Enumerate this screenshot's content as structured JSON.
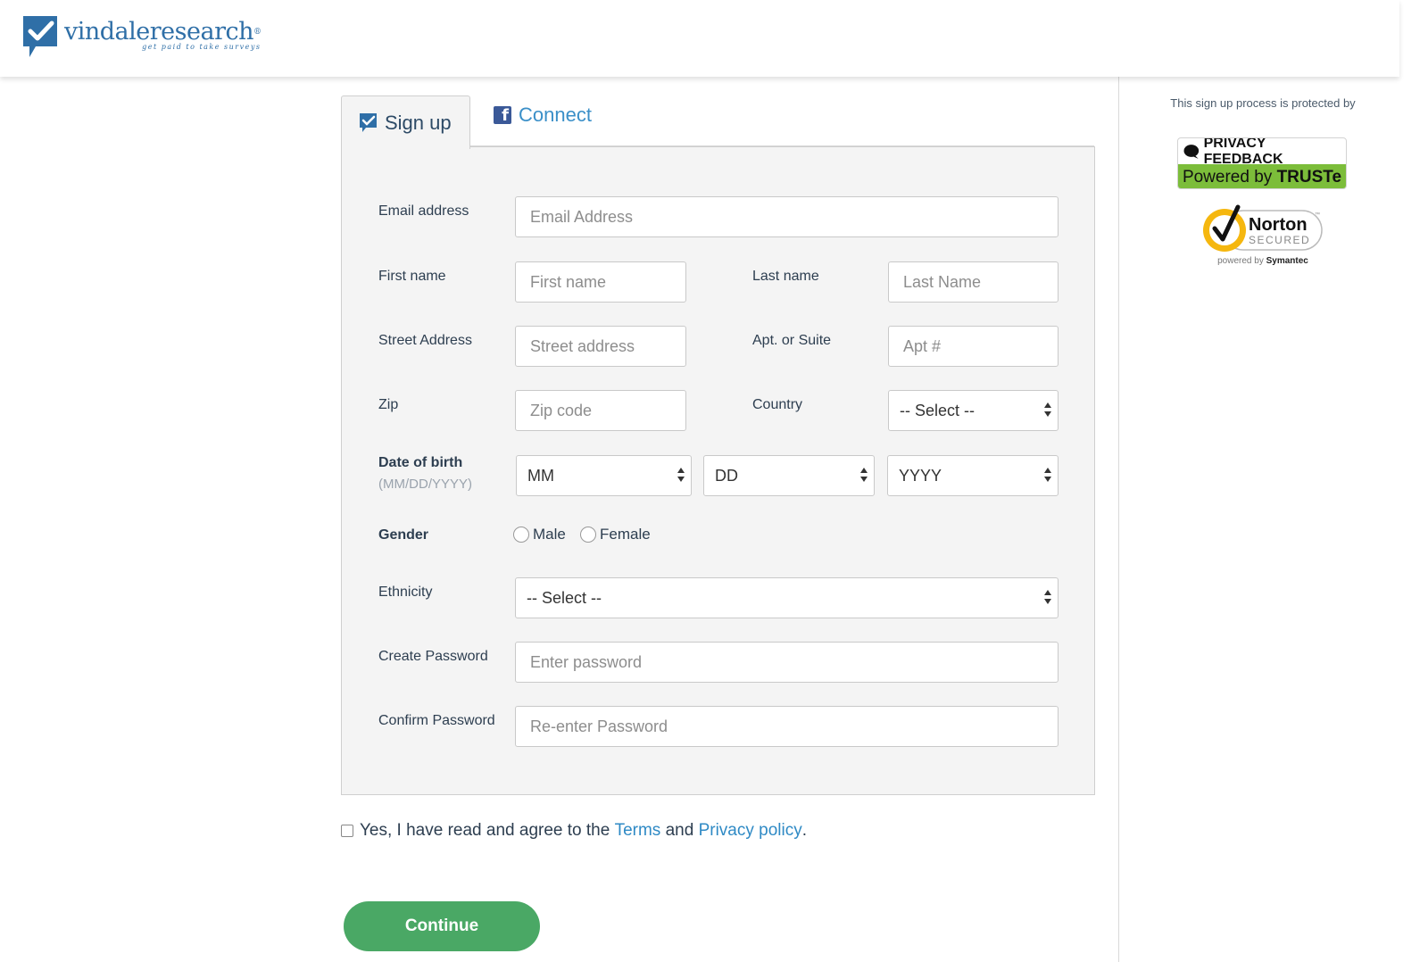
{
  "brand": {
    "name": "vindaleresearch",
    "registered": "®",
    "tagline": "get paid to take surveys"
  },
  "tabs": {
    "signup_label": "Sign up",
    "connect_label": "Connect",
    "facebook_glyph": "f"
  },
  "form": {
    "email": {
      "label": "Email address",
      "placeholder": "Email Address"
    },
    "first_name": {
      "label": "First name",
      "placeholder": "First name"
    },
    "last_name": {
      "label": "Last name",
      "placeholder": "Last Name"
    },
    "street": {
      "label": "Street Address",
      "placeholder": "Street address"
    },
    "apt": {
      "label": "Apt. or Suite",
      "placeholder": "Apt #"
    },
    "zip": {
      "label": "Zip",
      "placeholder": "Zip code"
    },
    "country": {
      "label": "Country",
      "selected": "-- Select --"
    },
    "dob": {
      "label": "Date of birth",
      "hint": "(MM/DD/YYYY)",
      "month": "MM",
      "day": "DD",
      "year": "YYYY"
    },
    "gender": {
      "label": "Gender",
      "options": [
        "Male",
        "Female"
      ]
    },
    "ethnicity": {
      "label": "Ethnicity",
      "selected": "-- Select --"
    },
    "password": {
      "label": "Create Password",
      "placeholder": "Enter password"
    },
    "confirm": {
      "label": "Confirm Password",
      "placeholder": "Re-enter Password"
    }
  },
  "agreement": {
    "prefix": "Yes, I have read and agree to the",
    "terms": "Terms",
    "and": "and",
    "privacy": "Privacy policy",
    "suffix": "."
  },
  "continue_label": "Continue",
  "sidebar": {
    "protected_text": "This sign up process is protected by",
    "truste_top": "PRIVACY FEEDBACK",
    "truste_bottom_prefix": "Powered by",
    "truste_bottom_brand": "TRUSTe",
    "norton_name": "Norton",
    "norton_secured": "SECURED",
    "norton_tm": "™",
    "norton_caption_prefix": "powered by",
    "norton_caption_brand": "Symantec"
  },
  "colors": {
    "brand_blue": "#2f6fa7",
    "link_blue": "#2f8ac5",
    "continue_green": "#4aa865",
    "truste_green": "#7cbd3a",
    "norton_yellow": "#f5b70f"
  }
}
